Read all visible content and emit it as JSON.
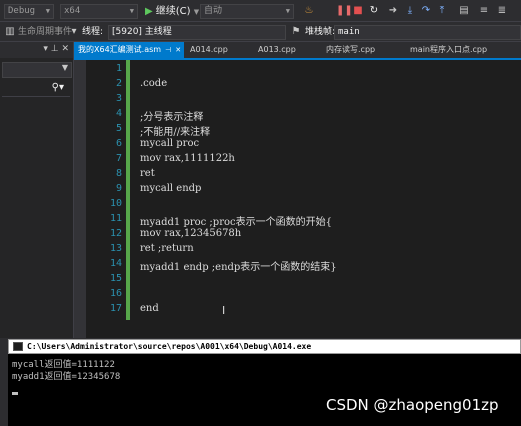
{
  "toolbar": {
    "config": "Debug",
    "platform": "x64",
    "continue_label": "继续(C)",
    "auto_label": "自动"
  },
  "toolbar2": {
    "lifecycle_label": "生命周期事件",
    "thread_label": "线程:",
    "thread_value": "[5920] 主线程",
    "stack_label": "堆栈帧:",
    "stack_value": "main"
  },
  "tabs": [
    {
      "label": "我的X64汇编测试.asm",
      "active": true
    },
    {
      "label": "A014.cpp"
    },
    {
      "label": "A013.cpp"
    },
    {
      "label": "内存读写.cpp"
    },
    {
      "label": "main程序入口点.cpp"
    }
  ],
  "editor": {
    "lines": [
      {
        "n": "1",
        "text": ""
      },
      {
        "n": "2",
        "text": ".code"
      },
      {
        "n": "3",
        "text": ""
      },
      {
        "n": "4",
        "text": ";分号表示注释"
      },
      {
        "n": "5",
        "text": ";不能用//来注释"
      },
      {
        "n": "6",
        "text": "mycall proc"
      },
      {
        "n": "7",
        "text": "mov rax,1111122h"
      },
      {
        "n": "8",
        "text": "ret"
      },
      {
        "n": "9",
        "text": "mycall endp"
      },
      {
        "n": "10",
        "text": ""
      },
      {
        "n": "11",
        "text": "myadd1 proc ;proc表示一个函数的开始{"
      },
      {
        "n": "12",
        "text": "mov rax,12345678h"
      },
      {
        "n": "13",
        "text": "ret ;return"
      },
      {
        "n": "14",
        "text": "myadd1 endp ;endp表示一个函数的结束}"
      },
      {
        "n": "15",
        "text": ""
      },
      {
        "n": "16",
        "text": ""
      },
      {
        "n": "17",
        "text": "end"
      }
    ]
  },
  "console": {
    "title": "C:\\Users\\Administrator\\source\\repos\\A001\\x64\\Debug\\A014.exe",
    "lines": [
      "mycall返回值=1111122",
      "myadd1返回值=12345678"
    ]
  },
  "watermark": "CSDN @zhaopeng01zp"
}
